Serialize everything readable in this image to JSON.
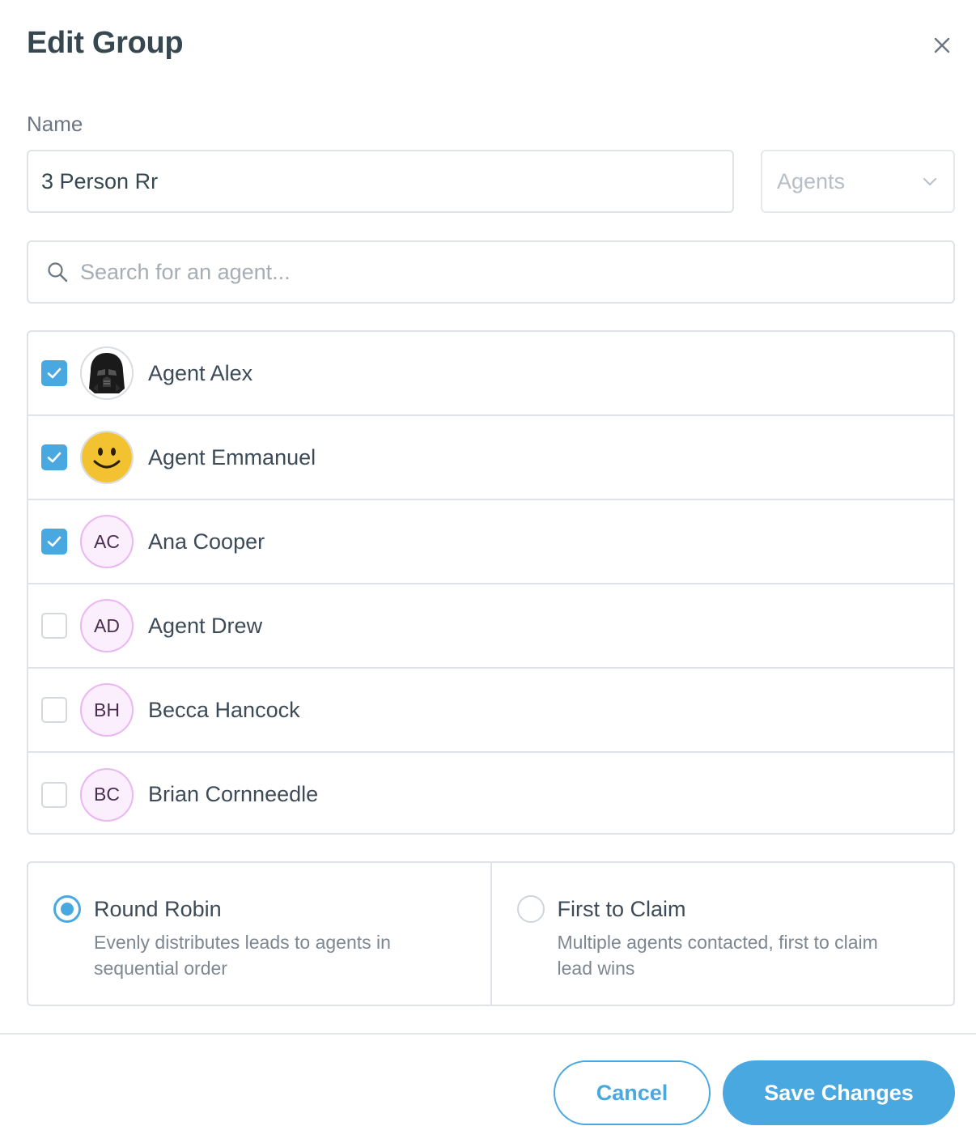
{
  "dialog": {
    "title": "Edit Group"
  },
  "form": {
    "name_label": "Name",
    "name_value": "3 Person Rr",
    "role_select": "Agents",
    "search_placeholder": "Search for an agent..."
  },
  "agents": [
    {
      "name": "Agent Alex",
      "checked": true,
      "avatar": "darth-vader-helmet"
    },
    {
      "name": "Agent Emmanuel",
      "checked": true,
      "avatar": "smiley-face"
    },
    {
      "name": "Ana Cooper",
      "checked": true,
      "initials": "AC"
    },
    {
      "name": "Agent Drew",
      "checked": false,
      "initials": "AD"
    },
    {
      "name": "Becca Hancock",
      "checked": false,
      "initials": "BH"
    },
    {
      "name": "Brian Cornneedle",
      "checked": false,
      "initials": "BC"
    }
  ],
  "distribution": {
    "selected": "round_robin",
    "options": [
      {
        "title": "Round Robin",
        "description": "Evenly distributes leads to agents in sequential order"
      },
      {
        "title": "First to Claim",
        "description": "Multiple agents contacted, first to claim lead wins"
      }
    ]
  },
  "footer": {
    "cancel_label": "Cancel",
    "save_label": "Save Changes"
  },
  "colors": {
    "accent": "#4aa8e0",
    "initials_bg": "#fbeefd",
    "initials_border": "#eab7f2"
  }
}
